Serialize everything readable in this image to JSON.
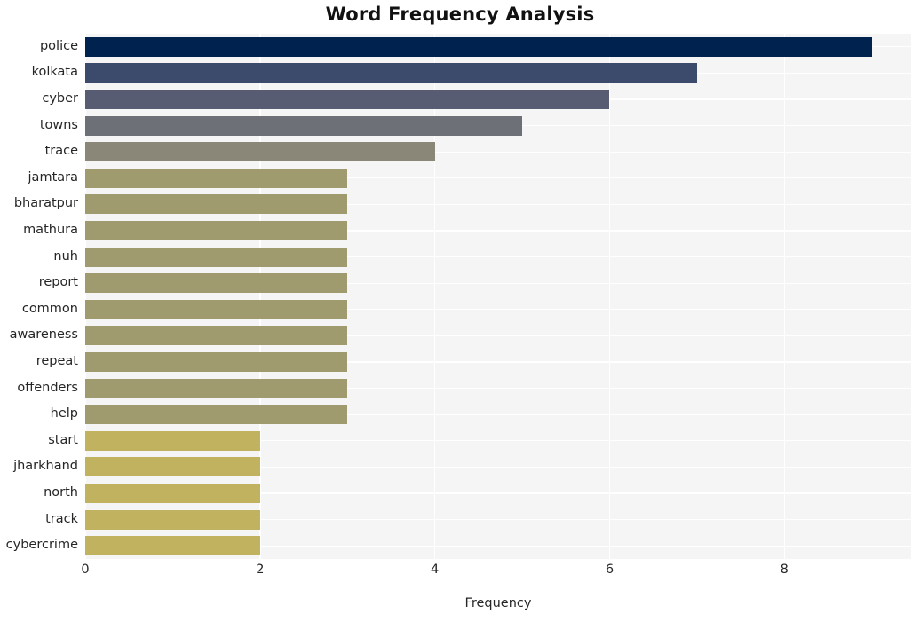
{
  "chart_data": {
    "type": "bar",
    "orientation": "horizontal",
    "title": "Word Frequency Analysis",
    "xlabel": "Frequency",
    "ylabel": "",
    "categories": [
      "police",
      "kolkata",
      "cyber",
      "towns",
      "trace",
      "jamtara",
      "bharatpur",
      "mathura",
      "nuh",
      "report",
      "common",
      "awareness",
      "repeat",
      "offenders",
      "help",
      "start",
      "jharkhand",
      "north",
      "track",
      "cybercrime"
    ],
    "values": [
      9,
      7,
      6,
      5,
      4,
      3,
      3,
      3,
      3,
      3,
      3,
      3,
      3,
      3,
      3,
      2,
      2,
      2,
      2,
      2
    ],
    "bar_colors": [
      "#00224e",
      "#3c4a6b",
      "#575c73",
      "#6e7077",
      "#8a8779",
      "#a09a6f",
      "#a09a6f",
      "#a09a6f",
      "#a09a6f",
      "#a09a6f",
      "#a09a6f",
      "#a09a6f",
      "#a09a6f",
      "#a09a6f",
      "#a09a6f",
      "#c1b25f",
      "#c1b25f",
      "#c1b25f",
      "#c1b25f",
      "#c1b25f"
    ],
    "xticks": [
      0,
      2,
      4,
      6,
      8
    ],
    "xtick_labels": [
      "0",
      "2",
      "4",
      "6",
      "8"
    ],
    "xlim": [
      0,
      9.45
    ],
    "grid": true,
    "legend": null,
    "colormap": "cividis",
    "style": "whitegrid",
    "plot_background": "#f5f5f6",
    "grid_color": "#ffffff",
    "figure_background": "#ffffff",
    "text_color": "#262626"
  }
}
